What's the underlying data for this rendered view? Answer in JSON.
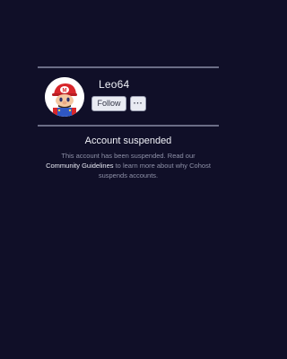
{
  "profile": {
    "username": "Leo64",
    "follow_label": "Follow",
    "more_label": "···",
    "avatar_icon": "mario-avatar-icon"
  },
  "notice": {
    "title": "Account suspended",
    "text_before": "This account has been suspended. Read our ",
    "link_text": "Community Guidelines",
    "text_after": " to learn more about why Cohost suspends accounts."
  },
  "colors": {
    "background": "#100f28",
    "divider": "#6b6d86",
    "button_bg": "#e9ebf2"
  }
}
